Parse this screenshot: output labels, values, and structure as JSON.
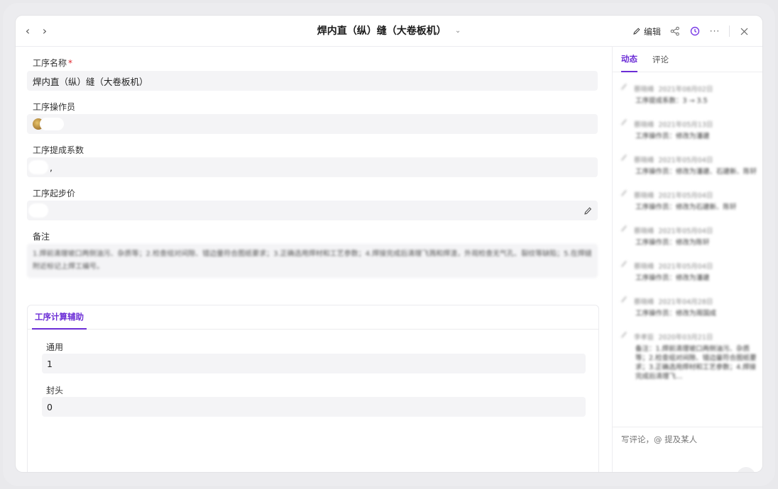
{
  "window": {
    "title": "焊内直（纵）缝（大卷板机）"
  },
  "toolbar": {
    "edit_label": "编辑"
  },
  "form": {
    "fields": [
      {
        "label": "工序名称",
        "required": true,
        "value": "焊内直（纵）缝（大卷板机）"
      },
      {
        "label": "工序操作员",
        "required": false,
        "value": ""
      },
      {
        "label": "工序提成系数",
        "required": false,
        "value": ","
      },
      {
        "label": "工序起步价",
        "required": false,
        "value": ""
      },
      {
        "label": "备注",
        "required": false,
        "value": "1.焊前清理坡口两侧油污、杂质等；2.检查组对间隙、错边量符合图纸要求；3.正确选用焊材和工艺参数；4.焊接完成后清理飞溅和焊渣，外观检查无气孔、裂纹等缺陷；5.在焊缝附近标记上焊工编号。"
      }
    ],
    "required_mark": "*"
  },
  "calc": {
    "tab_label": "工序计算辅助",
    "fields": [
      {
        "label": "通用",
        "value": "1"
      },
      {
        "label": "封头",
        "value": "0"
      }
    ]
  },
  "side": {
    "tabs": [
      {
        "label": "动态",
        "active": true
      },
      {
        "label": "评论",
        "active": false
      }
    ],
    "activities": [
      {
        "user": "蔡晓峰",
        "time": "2021年08月02日",
        "text": "工序提成系数：3 → 3.5"
      },
      {
        "user": "蔡晓峰",
        "time": "2021年05月13日",
        "text": "工序操作员：修改为潘建"
      },
      {
        "user": "蔡晓峰",
        "time": "2021年05月04日",
        "text": "工序操作员：修改为潘建、石建新、陈轩"
      },
      {
        "user": "蔡晓峰",
        "time": "2021年05月04日",
        "text": "工序操作员：修改为石建新、陈轩"
      },
      {
        "user": "蔡晓峰",
        "time": "2021年05月04日",
        "text": "工序操作员：修改为陈轩"
      },
      {
        "user": "蔡晓峰",
        "time": "2021年05月04日",
        "text": "工序操作员：修改为潘建"
      },
      {
        "user": "蔡晓峰",
        "time": "2021年04月28日",
        "text": "工序操作员：修改为周国成"
      },
      {
        "user": "李孝臣",
        "time": "2020年03月21日",
        "text": "备注：1.焊前清理坡口两侧油污、杂质等；2.检查组对间隙、错边量符合图纸要求；3.正确选用焊材和工艺参数；4.焊接完成后清理飞…"
      }
    ],
    "comment_placeholder": "写评论，@ 提及某人"
  }
}
